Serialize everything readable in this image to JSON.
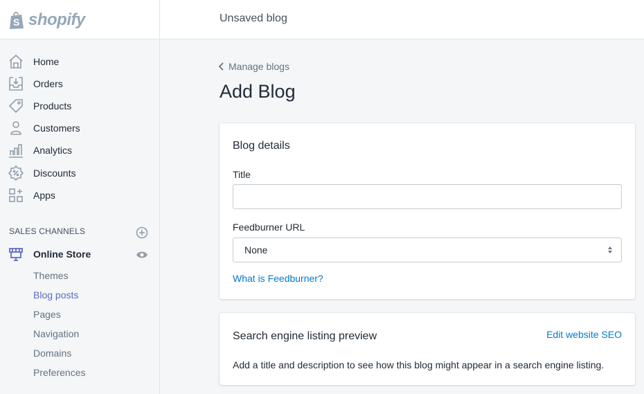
{
  "brand": {
    "name": "shopify"
  },
  "topbar": {
    "title": "Unsaved blog"
  },
  "sidebar": {
    "items": [
      {
        "label": "Home",
        "icon": "home-icon"
      },
      {
        "label": "Orders",
        "icon": "orders-icon"
      },
      {
        "label": "Products",
        "icon": "tag-icon"
      },
      {
        "label": "Customers",
        "icon": "person-icon"
      },
      {
        "label": "Analytics",
        "icon": "bar-chart-icon"
      },
      {
        "label": "Discounts",
        "icon": "discount-icon"
      },
      {
        "label": "Apps",
        "icon": "apps-icon"
      }
    ],
    "sales_channels": {
      "header": "SALES CHANNELS",
      "add_icon": "plus-circle-icon",
      "channel": {
        "label": "Online Store",
        "icon": "store-icon",
        "view_icon": "eye-icon"
      },
      "sub_items": [
        {
          "label": "Themes",
          "active": false
        },
        {
          "label": "Blog posts",
          "active": true
        },
        {
          "label": "Pages",
          "active": false
        },
        {
          "label": "Navigation",
          "active": false
        },
        {
          "label": "Domains",
          "active": false
        },
        {
          "label": "Preferences",
          "active": false
        }
      ]
    }
  },
  "main": {
    "breadcrumb": "Manage blogs",
    "page_title": "Add Blog",
    "blog_details": {
      "title": "Blog details",
      "title_label": "Title",
      "title_value": "",
      "feedburner_label": "Feedburner URL",
      "feedburner_value": "None",
      "feedburner_link": "What is Feedburner?"
    },
    "seo": {
      "title": "Search engine listing preview",
      "edit_link": "Edit website SEO",
      "description": "Add a title and description to see how this blog might appear in a search engine listing."
    }
  },
  "colors": {
    "accent": "#5c6ac4",
    "link": "#007ace",
    "icon_gray": "#919eab",
    "background": "#f4f6f8"
  }
}
